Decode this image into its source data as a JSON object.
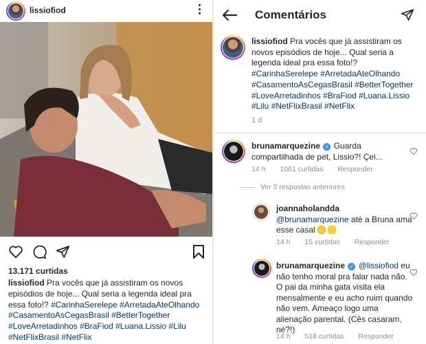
{
  "post": {
    "username": "lissiofiod",
    "likes": "13.171 curtidas",
    "caption_user": "lissiofiod",
    "caption_text": "Pra vocês que já assistiram os novos episódios de hoje... Qual seria a legenda ideal pra essa foto!?",
    "hashtags": "#CarinhaSerelepe #ArretadaAteOlhando #CasamentoAsCegasBrasil #BetterTogether #LoveArretadinhos #BraFiod #Luana.Lissio #Lilu #NetFlixBrasil #NetFlix"
  },
  "comments_screen": {
    "title": "Comentários",
    "caption_user": "lissiofiod",
    "caption_text": "Pra vocês que já assistiram os novos episódios de hoje... Qual seria a legenda ideal pra essa foto!?",
    "hashtags": "#CarinhaSerelepe #ArretadaAteOlhando #CasamentoAsCegasBrasil #BetterTogether #LoveArretadinhos #BraFiod #Luana.Lissio #Lilu #NetFlixBrasil #NetFlix",
    "caption_time": "1 d",
    "view_replies": "Ver 5 respostas anteriores",
    "comments": [
      {
        "user": "brunamarquezine",
        "text": "Guarda compartilhada de pet, Lissio?! Çei...",
        "time": "14 h",
        "likes": "1061 curtidas",
        "reply": "Responder"
      },
      {
        "user": "joannaholandda",
        "mention": "@brunamarquezine",
        "text": "até a Bruna ama esse casal",
        "time": "14 h",
        "likes": "15 curtidas",
        "reply": "Responder"
      },
      {
        "user": "brunamarquezine",
        "mention": "@lissiofiod",
        "text": "eu não tenho moral pra falar nada não. O pai da minha gata visita ela mensalmente e eu acho ruim quando não vem. Ameaço logo uma alienação parental. (Cês casaram, né?!)",
        "time": "14 h",
        "likes": "518 curtidas",
        "reply": "Responder"
      }
    ]
  },
  "colors": {
    "text": "#262626",
    "link": "#00376b",
    "muted": "#8e8e8e",
    "verified": "#3897f0"
  },
  "icons": [
    "more-vertical-icon",
    "heart-icon",
    "comment-icon",
    "share-icon",
    "bookmark-icon",
    "back-arrow-icon",
    "send-icon",
    "verified-badge-icon"
  ]
}
